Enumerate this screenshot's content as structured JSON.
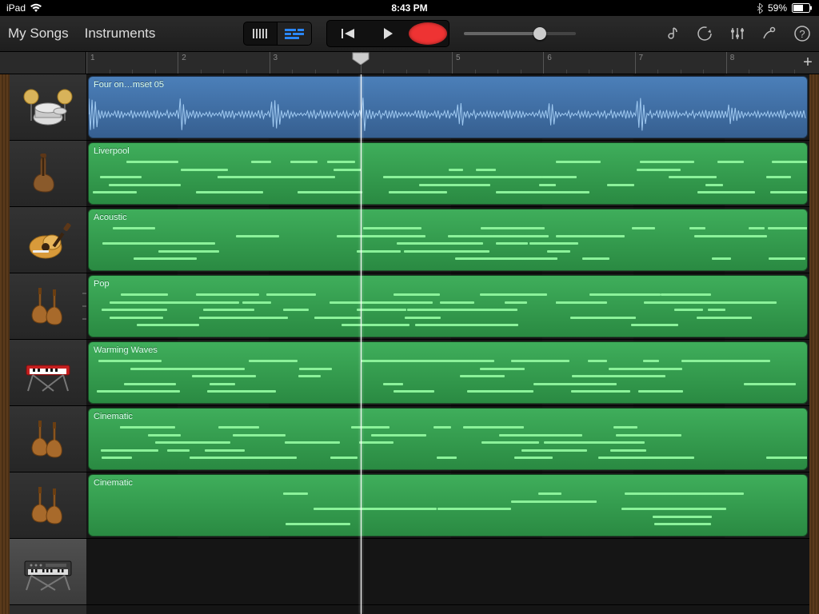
{
  "status": {
    "device": "iPad",
    "time": "8:43 PM",
    "battery_pct": "59%"
  },
  "toolbar": {
    "my_songs": "My Songs",
    "instruments": "Instruments"
  },
  "ruler": {
    "bars": [
      "1",
      "2",
      "3",
      "4",
      "5",
      "6",
      "7",
      "8"
    ],
    "playhead_bar": 4
  },
  "tracks": [
    {
      "instrument": "drums",
      "region_type": "audio",
      "region_label": "Four on…mset 05"
    },
    {
      "instrument": "bass",
      "region_type": "midi",
      "region_label": "Liverpool"
    },
    {
      "instrument": "guitar",
      "region_type": "midi",
      "region_label": "Acoustic"
    },
    {
      "instrument": "strings",
      "region_type": "midi",
      "region_label": "Pop"
    },
    {
      "instrument": "keyboard",
      "region_type": "midi",
      "region_label": "Warming Waves"
    },
    {
      "instrument": "strings",
      "region_type": "midi",
      "region_label": "Cinematic"
    },
    {
      "instrument": "strings",
      "region_type": "midi",
      "region_label": "Cinematic"
    },
    {
      "instrument": "synth",
      "region_type": "none",
      "region_label": ""
    }
  ],
  "selected_track_index": 7,
  "colors": {
    "audio_region": "#4b7fb9",
    "midi_region": "#3fae5b",
    "midi_note": "#8bf29a",
    "waveform": "#9ec8f0",
    "record": "#e33333",
    "active_view": "#2a87ff"
  }
}
